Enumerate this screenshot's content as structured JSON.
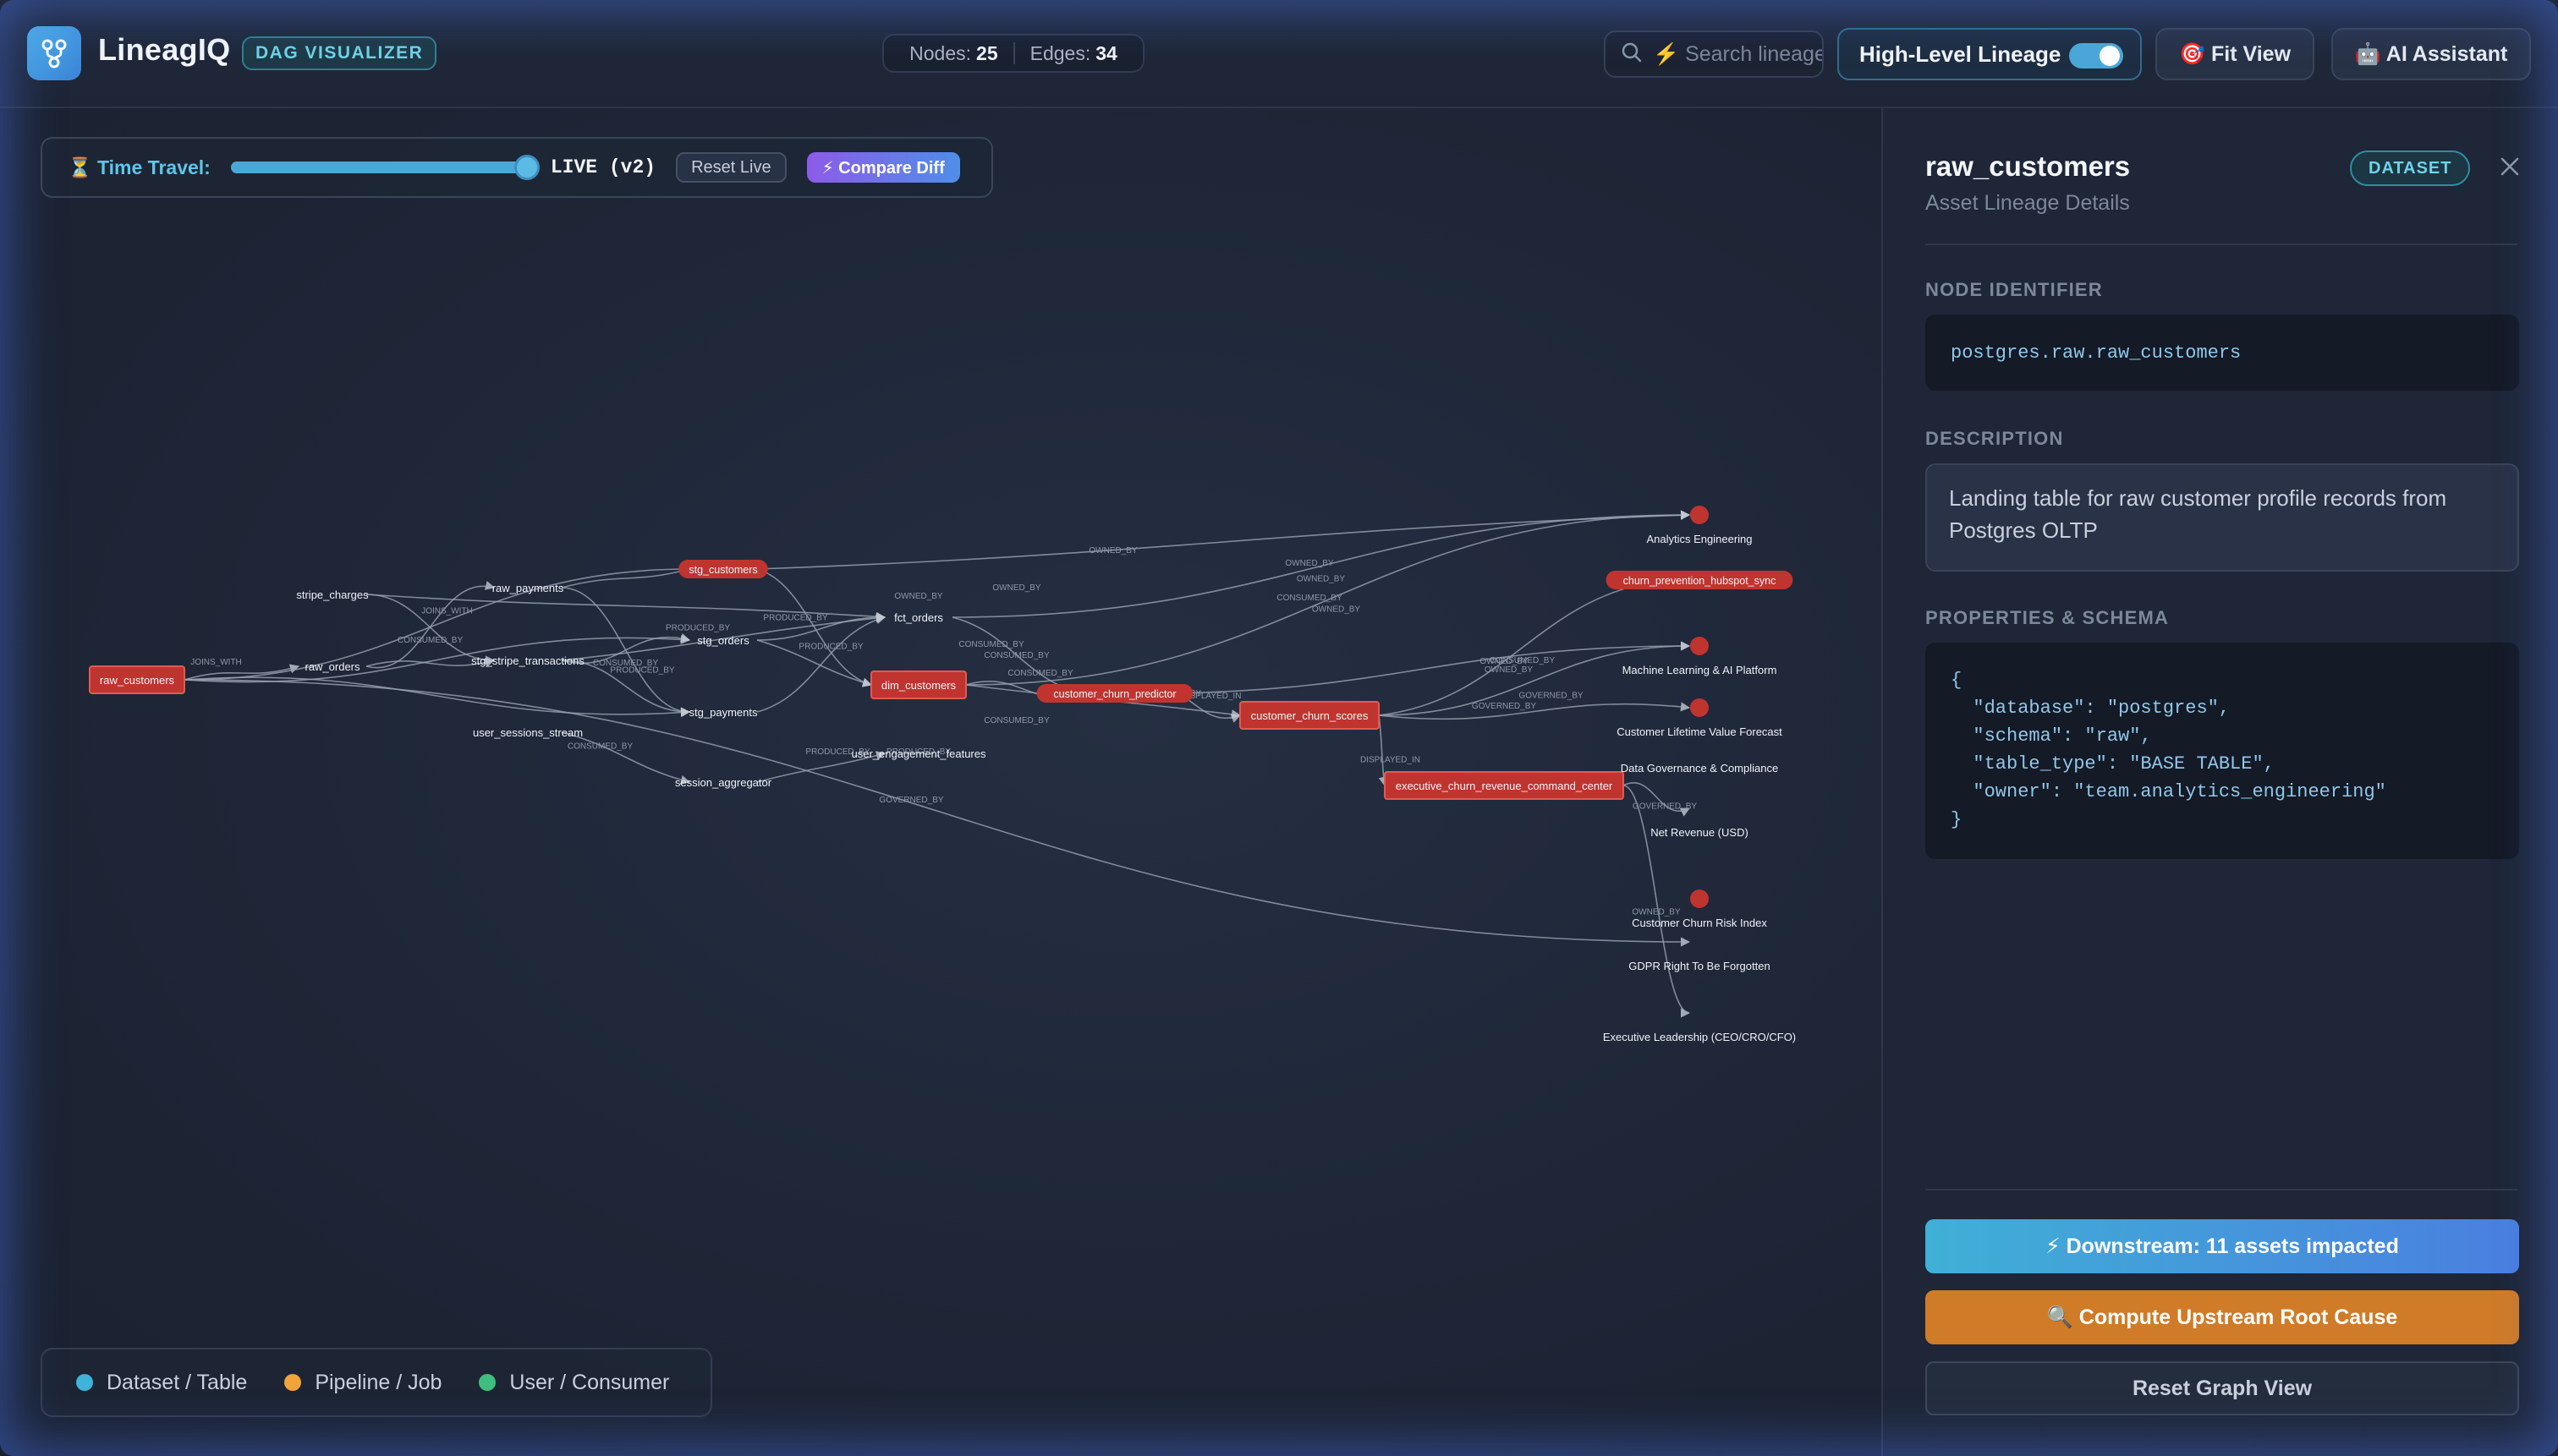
{
  "app": {
    "name": "LineagIQ",
    "badge": "DAG VISUALIZER"
  },
  "stats": {
    "nodes_label": "Nodes:",
    "nodes_value": "25",
    "edges_label": "Edges:",
    "edges_value": "34"
  },
  "search": {
    "placeholder": "⚡ Search lineage"
  },
  "toggle": {
    "label": "High-Level Lineage",
    "on": true
  },
  "toolbar": {
    "fit_view": "🎯 Fit View",
    "ai_assistant": "🤖 AI Assistant"
  },
  "time_travel": {
    "label": "⏳ Time Travel:",
    "slider_value": 1.0,
    "live_label": "LIVE (v2)",
    "reset_label": "Reset Live",
    "compare_label": "⚡ Compare Diff"
  },
  "legend": [
    {
      "label": "Dataset / Table",
      "color": "#3fb3d9"
    },
    {
      "label": "Pipeline / Job",
      "color": "#f2a33a"
    },
    {
      "label": "User / Consumer",
      "color": "#3fbf7f"
    }
  ],
  "graph": {
    "nodes": [
      {
        "id": "raw_customers",
        "label": "raw_customers",
        "style": "box"
      },
      {
        "id": "stripe_charges",
        "label": "stripe_charges",
        "style": "text"
      },
      {
        "id": "raw_orders",
        "label": "raw_orders",
        "style": "text"
      },
      {
        "id": "raw_payments",
        "label": "raw_payments",
        "style": "text"
      },
      {
        "id": "stg_stripe_transactions",
        "label": "stg_stripe_transactions",
        "style": "text"
      },
      {
        "id": "stg_customers",
        "label": "stg_customers",
        "style": "pill"
      },
      {
        "id": "stg_orders",
        "label": "stg_orders",
        "style": "text"
      },
      {
        "id": "stg_payments",
        "label": "stg_payments",
        "style": "text"
      },
      {
        "id": "fct_orders",
        "label": "fct_orders",
        "style": "text"
      },
      {
        "id": "dim_customers",
        "label": "dim_customers",
        "style": "box"
      },
      {
        "id": "customer_churn_predictor",
        "label": "customer_churn_predictor",
        "style": "pill"
      },
      {
        "id": "customer_churn_scores",
        "label": "customer_churn_scores",
        "style": "box"
      },
      {
        "id": "executive_churn_revenue_command_center",
        "label": "executive_churn_revenue_command_center",
        "style": "box"
      },
      {
        "id": "user_sessions_stream",
        "label": "user_sessions_stream",
        "style": "text"
      },
      {
        "id": "session_aggregator",
        "label": "session_aggregator",
        "style": "text"
      },
      {
        "id": "user_engagement_features",
        "label": "user_engagement_features",
        "style": "text"
      },
      {
        "id": "analytics_engineering",
        "label": "Analytics Engineering",
        "style": "dot"
      },
      {
        "id": "churn_prevention_hubspot_sync",
        "label": "churn_prevention_hubspot_sync",
        "style": "pill"
      },
      {
        "id": "ml_ai_platform",
        "label": "Machine Learning & AI Platform",
        "style": "dot"
      },
      {
        "id": "clv_forecast",
        "label": "Customer Lifetime Value Forecast",
        "style": "dot"
      },
      {
        "id": "data_governance",
        "label": "Data Governance & Compliance",
        "style": "none"
      },
      {
        "id": "net_revenue",
        "label": "Net Revenue (USD)",
        "style": "none"
      },
      {
        "id": "churn_risk_index",
        "label": "Customer Churn Risk Index",
        "style": "dot"
      },
      {
        "id": "gdpr_rtbf",
        "label": "GDPR Right To Be Forgotten",
        "style": "none"
      },
      {
        "id": "exec_leadership",
        "label": "Executive Leadership (CEO/CRO/CFO)",
        "style": "none"
      }
    ],
    "edges": [
      {
        "from": "raw_customers",
        "to": "raw_orders",
        "label": "JOINS_WITH"
      },
      {
        "from": "raw_customers",
        "to": "stg_customers",
        "label": ""
      },
      {
        "from": "raw_customers",
        "to": "stg_orders",
        "label": ""
      },
      {
        "from": "raw_customers",
        "to": "stg_payments",
        "label": ""
      },
      {
        "from": "raw_customers",
        "to": "gdpr_rtbf",
        "label": "GOVERNED_BY"
      },
      {
        "from": "raw_orders",
        "to": "raw_payments",
        "label": "JOINS_WITH"
      },
      {
        "from": "raw_orders",
        "to": "stg_stripe_transactions",
        "label": ""
      },
      {
        "from": "stripe_charges",
        "to": "stg_stripe_transactions",
        "label": "CONSUMED_BY"
      },
      {
        "from": "stripe_charges",
        "to": "fct_orders",
        "label": ""
      },
      {
        "from": "raw_payments",
        "to": "stg_customers",
        "label": ""
      },
      {
        "from": "raw_payments",
        "to": "stg_payments",
        "label": ""
      },
      {
        "from": "stg_stripe_transactions",
        "to": "stg_orders",
        "label": "CONSUMED_BY"
      },
      {
        "from": "stg_stripe_transactions",
        "to": "fct_orders",
        "label": "PRODUCED_BY"
      },
      {
        "from": "stg_stripe_transactions",
        "to": "stg_payments",
        "label": "PRODUCED_BY"
      },
      {
        "from": "stg_customers",
        "to": "dim_customers",
        "label": ""
      },
      {
        "from": "stg_customers",
        "to": "analytics_engineering",
        "label": ""
      },
      {
        "from": "stg_orders",
        "to": "fct_orders",
        "label": "PRODUCED_BY"
      },
      {
        "from": "stg_orders",
        "to": "dim_customers",
        "label": "PRODUCED_BY"
      },
      {
        "from": "stg_payments",
        "to": "fct_orders",
        "label": ""
      },
      {
        "from": "fct_orders",
        "to": "analytics_engineering",
        "label": "OWNED_BY"
      },
      {
        "from": "fct_orders",
        "to": "customer_churn_predictor",
        "label": "CONSUMED_BY"
      },
      {
        "from": "dim_customers",
        "to": "customer_churn_predictor",
        "label": "CONSUMED_BY"
      },
      {
        "from": "dim_customers",
        "to": "analytics_engineering",
        "label": "OWNED_BY"
      },
      {
        "from": "dim_customers",
        "to": "customer_churn_scores",
        "label": ""
      },
      {
        "from": "customer_churn_predictor",
        "to": "customer_churn_scores",
        "label": "PRODUCED_BY"
      },
      {
        "from": "customer_churn_predictor",
        "to": "ml_ai_platform",
        "label": ""
      },
      {
        "from": "customer_churn_scores",
        "to": "executive_churn_revenue_command_center",
        "label": "DISPLAYED_IN"
      },
      {
        "from": "customer_churn_scores",
        "to": "churn_prevention_hubspot_sync",
        "label": "CONSUMED_BY"
      },
      {
        "from": "customer_churn_scores",
        "to": "ml_ai_platform",
        "label": "OWNED_BY"
      },
      {
        "from": "customer_churn_scores",
        "to": "clv_forecast",
        "label": "GOVERNED_BY"
      },
      {
        "from": "executive_churn_revenue_command_center",
        "to": "net_revenue",
        "label": "GOVERNED_BY"
      },
      {
        "from": "executive_churn_revenue_command_center",
        "to": "exec_leadership",
        "label": "OWNED_BY"
      },
      {
        "from": "user_sessions_stream",
        "to": "session_aggregator",
        "label": "CONSUMED_BY"
      },
      {
        "from": "session_aggregator",
        "to": "user_engagement_features",
        "label": "PRODUCED_BY"
      }
    ],
    "extra_edge_labels": [
      "OWNED_BY",
      "OWNED_BY",
      "OWNED_BY",
      "OWNED_BY",
      "CONSUMED_BY",
      "CONSUMED_BY",
      "CONSUMED_BY",
      "OWNED_BY",
      "PRODUCED_BY",
      "DISPLAYED_IN",
      "GOVERNED_BY"
    ]
  },
  "panel": {
    "title": "raw_customers",
    "subtitle": "Asset Lineage Details",
    "badge": "DATASET",
    "node_identifier_label": "NODE IDENTIFIER",
    "node_identifier": "postgres.raw.raw_customers",
    "description_label": "DESCRIPTION",
    "description": "Landing table for raw customer profile records from Postgres OLTP",
    "properties_label": "PROPERTIES & SCHEMA",
    "properties_json": "{\n  \"database\": \"postgres\",\n  \"schema\": \"raw\",\n  \"table_type\": \"BASE TABLE\",\n  \"owner\": \"team.analytics_engineering\"\n}",
    "downstream_button": "⚡ Downstream: 11 assets impacted",
    "upstream_button": "🔍 Compute Upstream Root Cause",
    "reset_button": "Reset Graph View"
  },
  "colors": {
    "accent": "#4aa8d8",
    "node_red": "#c0342f",
    "node_border": "#e25a50",
    "edge": "#9aa3b2",
    "upstream_orange": "#d07b28"
  }
}
